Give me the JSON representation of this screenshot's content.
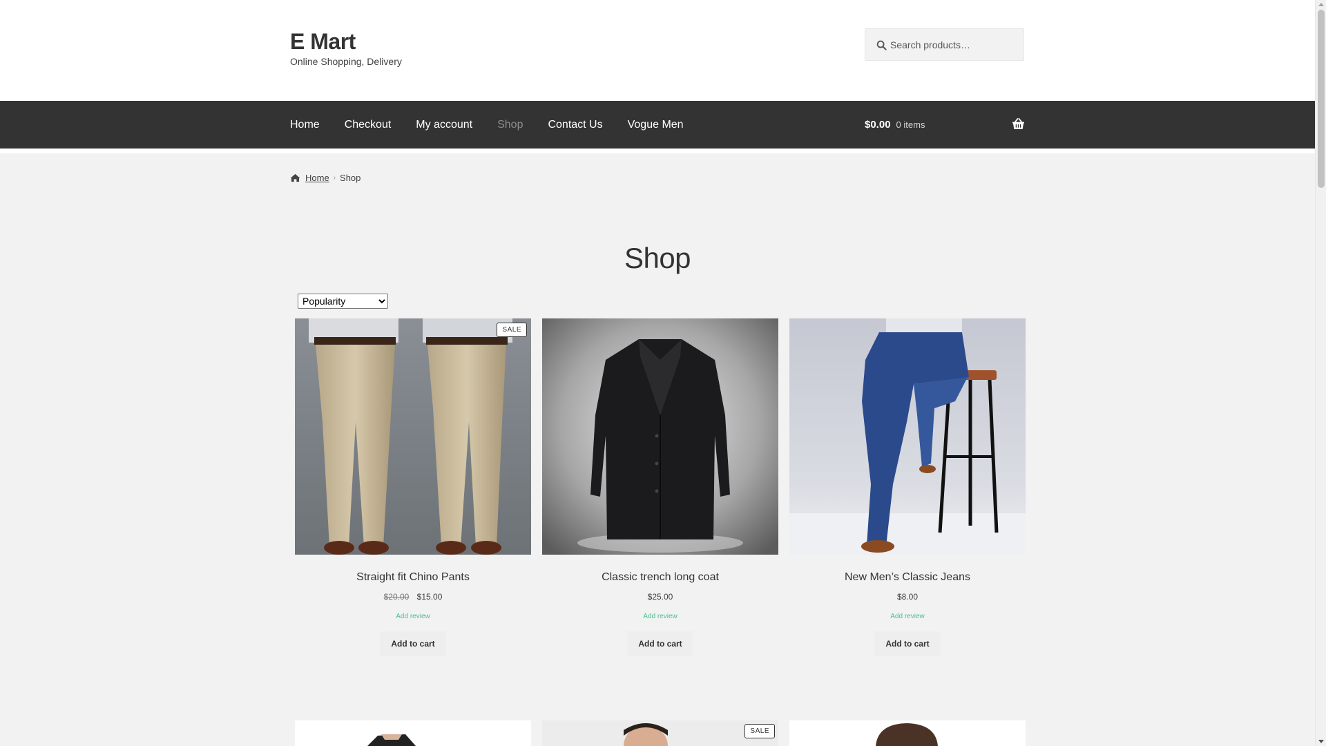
{
  "header": {
    "site_title": "E Mart",
    "site_description": "Online Shopping, Delivery",
    "search_placeholder": "Search products…"
  },
  "nav": {
    "items": [
      {
        "label": "Home",
        "active": false
      },
      {
        "label": "Checkout",
        "active": false
      },
      {
        "label": "My account",
        "active": false
      },
      {
        "label": "Shop",
        "active": true
      },
      {
        "label": "Contact Us",
        "active": false
      },
      {
        "label": "Vogue Men",
        "active": false
      }
    ],
    "cart_amount": "$0.00",
    "cart_count": "0 items"
  },
  "breadcrumb": {
    "home": "Home",
    "current": "Shop"
  },
  "page_title": "Shop",
  "sort": {
    "selected": "Popularity"
  },
  "products": [
    {
      "name": "Straight fit Chino Pants",
      "old_price": "$20.00",
      "price": "$15.00",
      "sale": "SALE",
      "review": "Add review",
      "button": "Add to cart"
    },
    {
      "name": "Classic trench long coat",
      "price": "$25.00",
      "review": "Add review",
      "button": "Add to cart"
    },
    {
      "name": "New Men’s Classic Jeans",
      "price": "$8.00",
      "review": "Add review",
      "button": "Add to cart"
    }
  ],
  "row2": {
    "sale": "SALE"
  },
  "colors": {
    "nav_bg": "#333333",
    "content_bg": "#f2f2f2",
    "review_link": "#47c190"
  }
}
